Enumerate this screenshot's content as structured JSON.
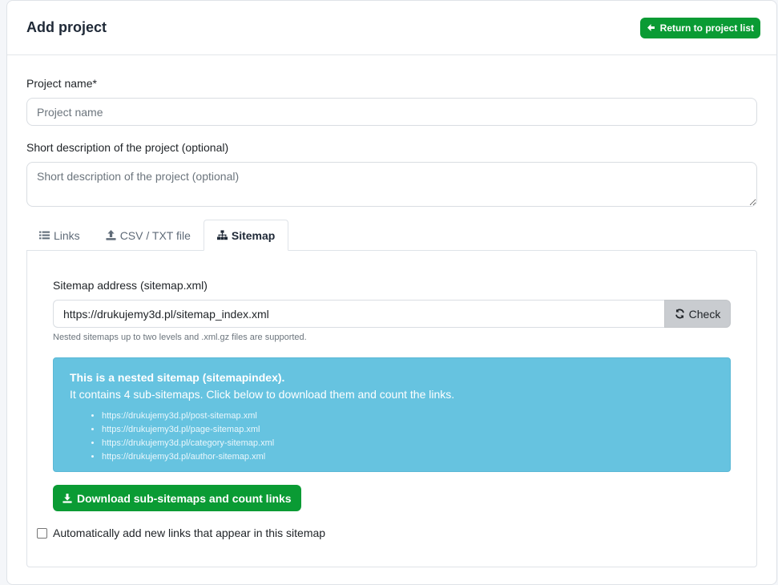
{
  "header": {
    "title": "Add project",
    "return_button_label": "Return to project list"
  },
  "form": {
    "project_name": {
      "label": "Project name*",
      "placeholder": "Project name",
      "value": ""
    },
    "description": {
      "label": "Short description of the project (optional)",
      "placeholder": "Short description of the project (optional)",
      "value": ""
    }
  },
  "tabs": [
    {
      "label": "Links",
      "icon": "list-icon",
      "active": false
    },
    {
      "label": "CSV / TXT file",
      "icon": "upload-icon",
      "active": false
    },
    {
      "label": "Sitemap",
      "icon": "sitemap-icon",
      "active": true
    }
  ],
  "sitemap": {
    "label": "Sitemap address (sitemap.xml)",
    "value": "https://drukujemy3d.pl/sitemap_index.xml",
    "check_button_label": "Check",
    "help_text": "Nested sitemaps up to two levels and .xml.gz files are supported.",
    "alert": {
      "title": "This is a nested sitemap (sitemapindex).",
      "text": "It contains 4 sub-sitemaps. Click below to download them and count the links.",
      "items": [
        "https://drukujemy3d.pl/post-sitemap.xml",
        "https://drukujemy3d.pl/page-sitemap.xml",
        "https://drukujemy3d.pl/category-sitemap.xml",
        "https://drukujemy3d.pl/author-sitemap.xml"
      ]
    },
    "download_button_label": "Download sub-sitemaps and count links",
    "auto_add_label": "Automatically add new links that appear in this sitemap",
    "auto_add_checked": false
  },
  "colors": {
    "primary_green": "#0a9b34",
    "alert_blue": "#66c3e0",
    "check_button_gray": "#c9ccd0"
  }
}
